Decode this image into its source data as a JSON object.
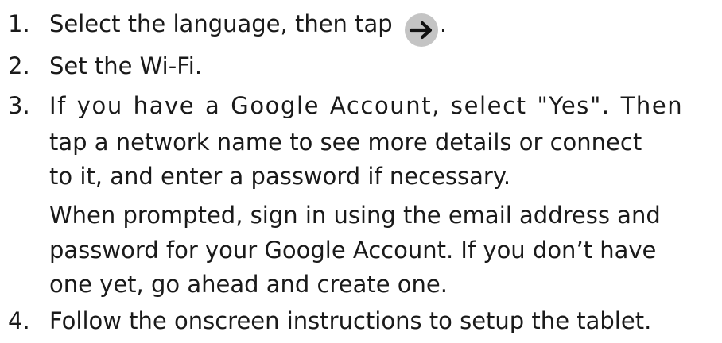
{
  "steps": [
    {
      "number": "1.",
      "text_before_icon": "Select the language, then tap ",
      "icon": "right-arrow-icon",
      "text_after_icon": "."
    },
    {
      "number": "2.",
      "text": "Set the Wi-Fi."
    },
    {
      "number": "3.",
      "lines": [
        "If you have a Google Account, select \"Yes\". Then",
        "tap a network name to see more details or connect",
        "to it, and enter a password if necessary."
      ],
      "note_lines": [
        "When prompted, sign in using the email address and",
        "password for your Google Account. If you don’t have",
        "one yet, go ahead and create one."
      ]
    },
    {
      "number": "4.",
      "text": "Follow the onscreen instructions to setup the tablet."
    }
  ],
  "colors": {
    "text": "#1a1a1a",
    "icon_background": "#c4c4c4"
  }
}
